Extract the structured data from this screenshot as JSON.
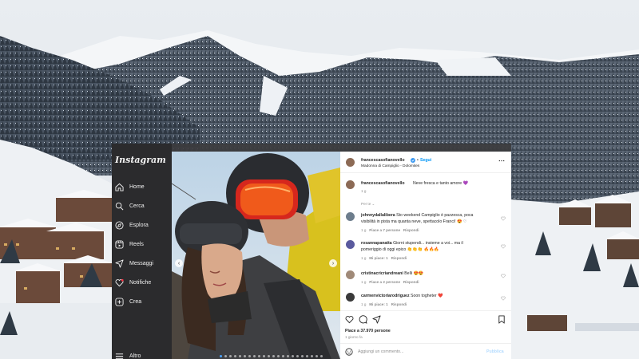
{
  "sidebar": {
    "logo": "Instagram",
    "items": [
      {
        "label": "Home",
        "icon": "home-icon"
      },
      {
        "label": "Cerca",
        "icon": "search-icon"
      },
      {
        "label": "Esplora",
        "icon": "compass-icon"
      },
      {
        "label": "Reels",
        "icon": "reels-icon"
      },
      {
        "label": "Messaggi",
        "icon": "messenger-icon"
      },
      {
        "label": "Notifiche",
        "icon": "heart-icon"
      },
      {
        "label": "Crea",
        "icon": "plus-square-icon"
      }
    ],
    "more_label": "Altro"
  },
  "post": {
    "username": "francescasofianovello",
    "follow_separator": "•",
    "follow_label": "Segui",
    "location": "Madonna di Campiglio - Dolomites",
    "caption_user": "francescasofianovello",
    "caption_text": "Neve fresca e tanto amore 💜",
    "caption_time": "1 g"
  },
  "comments": {
    "filter_label": "Per te",
    "items": [
      {
        "user": "johnnydallalibera",
        "line1": "Sto weekend Campiglio è pazzesca, poca",
        "line2": "visibilità in pista ma quanta neve, spettacolo Franci! 😍 ♡",
        "time": "1 g",
        "likes": "Piace a 7 persone",
        "reply": "Rispondi"
      },
      {
        "user": "rosannapanatta",
        "line1": "Giorni stupendi... insieme a voi... ma il",
        "line2": "pomeriggio di oggi epico 👏👏👏 🔥🔥🔥",
        "time": "1 g",
        "likes": "Mi piace: 1",
        "reply": "Rispondi"
      },
      {
        "user": "cristinacricriandreani",
        "line1": "Belli 😍😍",
        "line2": "",
        "time": "1 g",
        "likes": "Piace a 2 persone",
        "reply": "Rispondi"
      },
      {
        "user": "carmenvictoriarodriguez",
        "line1": "Soon togheter ❤️",
        "line2": "",
        "time": "1 g",
        "likes": "Mi piace: 1",
        "reply": "Rispondi"
      }
    ]
  },
  "actions": {
    "likes": "Piace a 37.970 persone",
    "time": "1 giorno fa",
    "comment_placeholder": "Aggiungi un commento...",
    "publish": "Pubblica"
  },
  "colors": {
    "accent_blue": "#0095f6",
    "verified": "#3897f0",
    "sidebar_bg": "#2b2b2d"
  }
}
